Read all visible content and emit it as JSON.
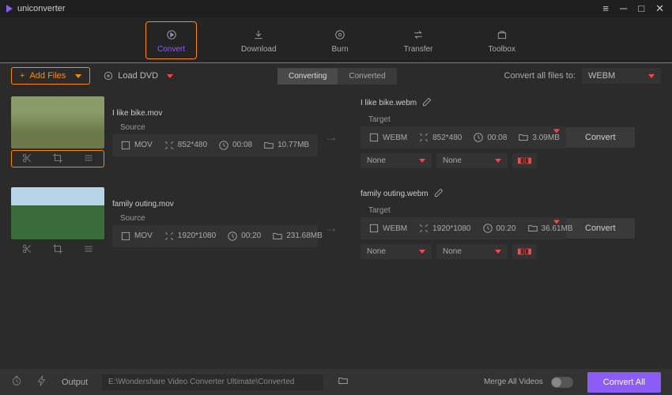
{
  "app": {
    "title": "uniconverter"
  },
  "nav": {
    "convert": "Convert",
    "download": "Download",
    "burn": "Burn",
    "transfer": "Transfer",
    "toolbox": "Toolbox"
  },
  "toolbar": {
    "add_files": "Add Files",
    "load_dvd": "Load DVD",
    "tab_converting": "Converting",
    "tab_converted": "Converted",
    "convert_all_to": "Convert all files to:",
    "format": "WEBM"
  },
  "files": [
    {
      "source_name": "I like bike.mov",
      "target_name": "I like bike.webm",
      "source": {
        "header": "Source",
        "fmt": "MOV",
        "res": "852*480",
        "dur": "00:08",
        "size": "10.77MB"
      },
      "target": {
        "header": "Target",
        "fmt": "WEBM",
        "res": "852*480",
        "dur": "00:08",
        "size": "3.09MB"
      },
      "dd1": "None",
      "dd2": "None"
    },
    {
      "source_name": "family outing.mov",
      "target_name": "family outing.webm",
      "source": {
        "header": "Source",
        "fmt": "MOV",
        "res": "1920*1080",
        "dur": "00:20",
        "size": "231.68MB"
      },
      "target": {
        "header": "Target",
        "fmt": "WEBM",
        "res": "1920*1080",
        "dur": "00:20",
        "size": "36.61MB"
      },
      "dd1": "None",
      "dd2": "None"
    }
  ],
  "btn_convert": "Convert",
  "bottom": {
    "output_label": "Output",
    "output_path": "E:\\Wondershare Video Converter Ultimate\\Converted",
    "merge": "Merge All Videos",
    "convert_all": "Convert All"
  }
}
